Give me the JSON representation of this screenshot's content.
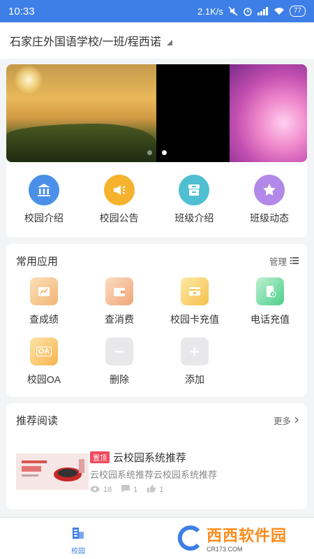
{
  "status_bar": {
    "time": "10:33",
    "speed": "2.1K/s",
    "signal": "4G",
    "battery": "77"
  },
  "header": {
    "path": "石家庄外国语学校/一班/程西诺"
  },
  "banner": {
    "slides": 3,
    "active_index": 1
  },
  "quick_nav": [
    {
      "label": "校园介绍",
      "icon": "institution-icon",
      "color": "#4a90e8"
    },
    {
      "label": "校园公告",
      "icon": "megaphone-icon",
      "color": "#f5b22d"
    },
    {
      "label": "班级介绍",
      "icon": "archive-icon",
      "color": "#4fbfd1"
    },
    {
      "label": "班级动态",
      "icon": "star-icon",
      "color": "#b288e8"
    }
  ],
  "apps": {
    "title": "常用应用",
    "manage_label": "管理",
    "items": [
      {
        "label": "查成绩",
        "icon": "chart-icon"
      },
      {
        "label": "查消费",
        "icon": "wallet-icon"
      },
      {
        "label": "校园卡充值",
        "icon": "card-icon"
      },
      {
        "label": "电话充值",
        "icon": "phone-topup-icon"
      },
      {
        "label": "校园OA",
        "icon": "oa-icon",
        "icon_text": "OA"
      },
      {
        "label": "删除",
        "icon": "minus-icon"
      },
      {
        "label": "添加",
        "icon": "plus-icon"
      }
    ]
  },
  "reading": {
    "title": "推荐阅读",
    "more_label": "更多",
    "article": {
      "tag": "置顶",
      "title": "云校园系统推荐",
      "desc": "云校园系统推荐云校园系统推荐",
      "views": "18",
      "comments": "1",
      "likes": "1"
    }
  },
  "bottom_nav": {
    "items": [
      {
        "label": "校园"
      }
    ]
  },
  "watermark": {
    "text": "西西软件园",
    "sub": "CR173.COM"
  }
}
